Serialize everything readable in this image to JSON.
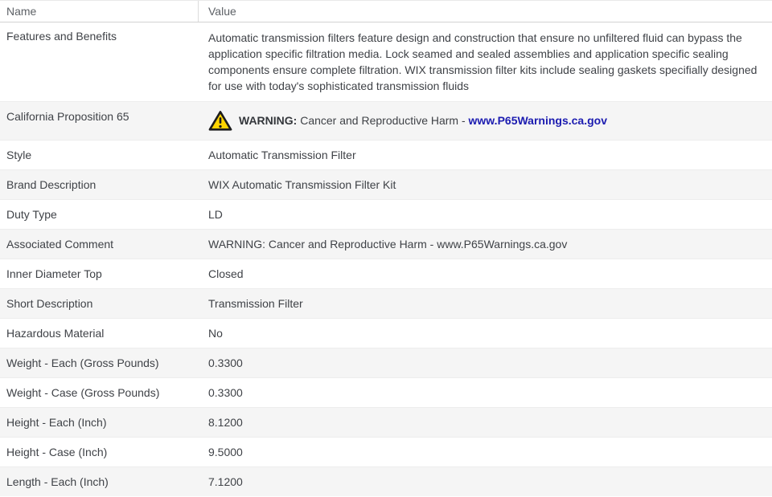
{
  "header": {
    "name_label": "Name",
    "value_label": "Value"
  },
  "features_row": {
    "name": "Features and Benefits",
    "value": "Automatic transmission filters feature design and construction that ensure no unfiltered fluid can bypass the application specific filtration media. Lock seamed and sealed assemblies and application specific sealing components ensure complete filtration. WIX transmission filter kits include sealing gaskets specifially designed for use with today's sophisticated transmission fluids"
  },
  "prop65_row": {
    "name": "California Proposition 65",
    "warning_label": "WARNING:",
    "warning_text": " Cancer and Reproductive Harm - ",
    "link_text": "www.P65Warnings.ca.gov",
    "icon": "warning-triangle-icon",
    "icon_fill_color": "#FFD400",
    "icon_border_color": "#1c1c1c",
    "link_color": "#1b1bb0"
  },
  "rows": [
    {
      "name": "Style",
      "value": "Automatic Transmission Filter"
    },
    {
      "name": "Brand Description",
      "value": "WIX Automatic Transmission Filter Kit"
    },
    {
      "name": "Duty Type",
      "value": "LD"
    },
    {
      "name": "Associated Comment",
      "value": "WARNING: Cancer and Reproductive Harm - www.P65Warnings.ca.gov"
    },
    {
      "name": "Inner Diameter Top",
      "value": "Closed"
    },
    {
      "name": "Short Description",
      "value": "Transmission Filter"
    },
    {
      "name": "Hazardous Material",
      "value": "No"
    },
    {
      "name": "Weight - Each (Gross Pounds)",
      "value": "0.3300"
    },
    {
      "name": "Weight - Case (Gross Pounds)",
      "value": "0.3300"
    },
    {
      "name": "Height - Each (Inch)",
      "value": "8.1200"
    },
    {
      "name": "Height - Case (Inch)",
      "value": "9.5000"
    },
    {
      "name": "Length - Each (Inch)",
      "value": "7.1200"
    }
  ],
  "colors": {
    "row_alt_background": "#f5f5f5",
    "row_background": "#ffffff",
    "text": "#3f4247",
    "header_text": "#5d6166"
  }
}
